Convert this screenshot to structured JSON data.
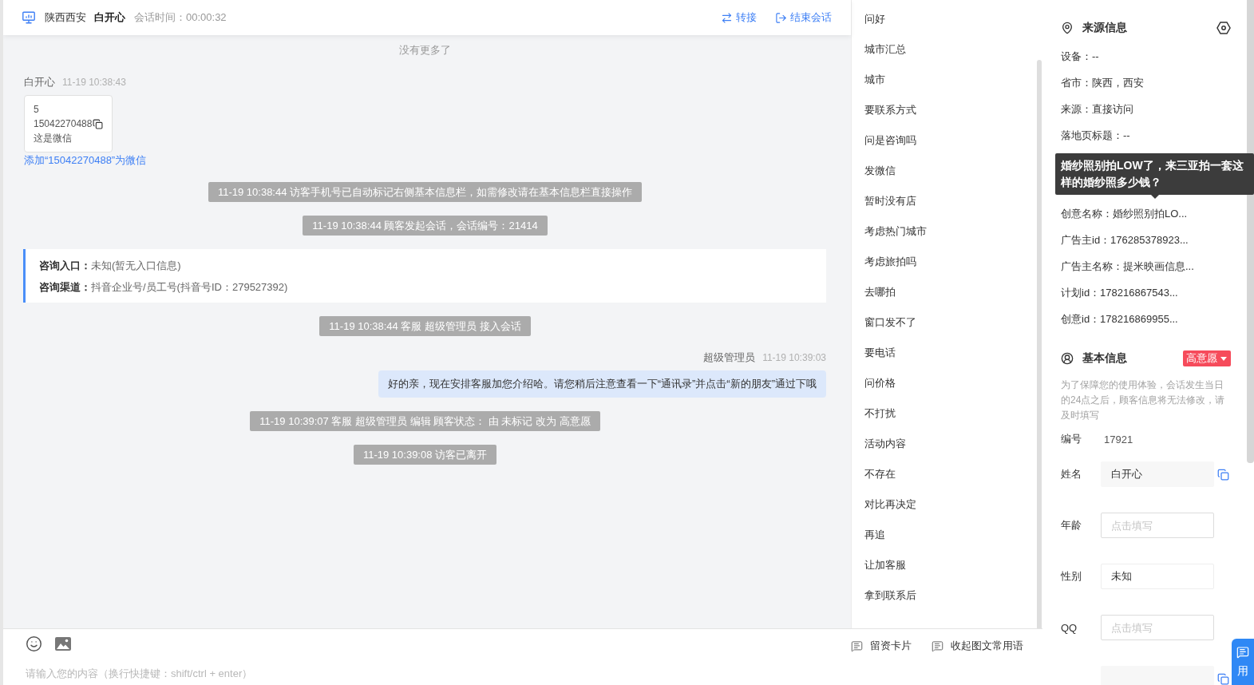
{
  "header": {
    "location": "陕西西安",
    "visitor": "白开心",
    "session_time": "会话时间：00:00:32",
    "actions": [
      {
        "kind": "transfer",
        "label": "转接"
      },
      {
        "kind": "end",
        "label": "结束会话"
      }
    ]
  },
  "chat": {
    "no_more": "没有更多了",
    "messages": [
      {
        "kind": "visitor",
        "sender": "白开心",
        "time": "11-19 10:38:43",
        "lines": [
          {
            "text": "5"
          },
          {
            "text": "15042270488",
            "copy": true
          },
          {
            "text": "这是微信"
          }
        ],
        "link": "添加“15042270488”为微信"
      },
      {
        "kind": "system",
        "text": "11-19 10:38:44 访客手机号已自动标记右侧基本信息栏，如需修改请在基本信息栏直接操作"
      },
      {
        "kind": "system",
        "text": "11-19 10:38:44 顾客发起会话，会话编号：21414"
      },
      {
        "kind": "info",
        "rows": [
          {
            "label": "咨询入口：",
            "value": "未知(暂无入口信息)"
          },
          {
            "label": "咨询渠道：",
            "value": "抖音企业号/员工号(抖音号ID：279527392)"
          }
        ]
      },
      {
        "kind": "system",
        "text": "11-19 10:38:44 客服 超级管理员 接入会话"
      },
      {
        "kind": "agent",
        "sender": "超级管理员",
        "time": "11-19 10:39:03",
        "text": "好的亲，现在安排客服加您介绍哈。请您稍后注意查看一下“通讯录”并点击“新的朋友”通过下哦"
      },
      {
        "kind": "system",
        "text": "11-19 10:39:07 客服 超级管理员 编辑 顾客状态： 由 未标记 改为 高意愿"
      },
      {
        "kind": "system",
        "text": "11-19 10:39:08 访客已离开"
      }
    ]
  },
  "quick_replies": [
    "问好",
    "城市汇总",
    "城市",
    "要联系方式",
    "问是咨询吗",
    "发微信",
    "暂时没有店",
    "考虑热门城市",
    "考虑旅拍吗",
    "去哪拍",
    "窗口发不了",
    "要电话",
    "问价格",
    "不打扰",
    "活动内容",
    "不存在",
    "对比再决定",
    "再追",
    "让加客服",
    "拿到联系后"
  ],
  "composer": {
    "actions": [
      {
        "label": "留资卡片"
      },
      {
        "label": "收起图文常用语"
      }
    ],
    "placeholder": "请输入您的内容（换行快捷键：shift/ctrl + enter）"
  },
  "source_info": {
    "title": "来源信息",
    "rows": [
      {
        "text": "设备：--"
      },
      {
        "text": "省市：陕西，西安"
      },
      {
        "text": "来源：直接访问"
      },
      {
        "text": "落地页标题：--"
      },
      {
        "text": "创意名称：婚纱照别拍LO...",
        "tooltip": "婚纱照别拍LOW了，来三亚拍一套这样的婚纱照多少钱？"
      },
      {
        "text": "广告主id：176285378923..."
      },
      {
        "text": "广告主名称：提米映画信息..."
      },
      {
        "text": "计划id：178216867543..."
      },
      {
        "text": "创意id：178216869955..."
      }
    ]
  },
  "basic_info": {
    "title": "基本信息",
    "status": "高意愿",
    "notice": "为了保障您的使用体验，会话发生当日的24点之后，顾客信息将无法修改，请及时填写",
    "fields": [
      {
        "kind": "text",
        "label": "编号",
        "value": "17921"
      },
      {
        "kind": "readonly",
        "label": "姓名",
        "value": "白开心",
        "copy": true
      },
      {
        "kind": "input",
        "label": "年龄",
        "placeholder": "点击填写"
      },
      {
        "kind": "select",
        "label": "性别",
        "value": "未知"
      },
      {
        "kind": "input",
        "label": "QQ",
        "placeholder": "点击填写"
      },
      {
        "kind": "readonly",
        "copy": true
      }
    ]
  },
  "feedback_button": {
    "label": "用"
  }
}
